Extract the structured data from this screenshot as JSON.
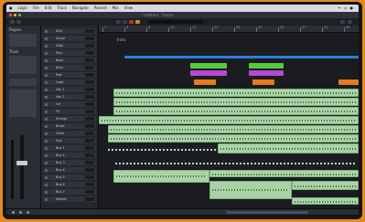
{
  "menubar": {
    "apple": "",
    "items": [
      "Logic",
      "File",
      "Edit",
      "Track",
      "Navigate",
      "Record",
      "Mix",
      "View"
    ],
    "status": [
      "ᯤ",
      "▭",
      "●"
    ]
  },
  "window": {
    "title": "Untitled - Tracks"
  },
  "inspector": {
    "region_label": "Region",
    "track_label": "Track"
  },
  "tracks": [
    {
      "name": "Kick"
    },
    {
      "name": "Snare"
    },
    {
      "name": "Hats"
    },
    {
      "name": "Perc"
    },
    {
      "name": "Bass"
    },
    {
      "name": "Keys"
    },
    {
      "name": "Pad"
    },
    {
      "name": "Lead"
    },
    {
      "name": "Vox 1"
    },
    {
      "name": "Vox 2"
    },
    {
      "name": "Gtr"
    },
    {
      "name": "FX"
    },
    {
      "name": "Strings"
    },
    {
      "name": "Brass"
    },
    {
      "name": "Choir"
    },
    {
      "name": "Sub"
    },
    {
      "name": "Bus 1"
    },
    {
      "name": "Bus 2"
    },
    {
      "name": "Bus 3"
    },
    {
      "name": "Bus 4"
    },
    {
      "name": "Bus 5"
    },
    {
      "name": "Bus 6"
    },
    {
      "name": "Bus 7"
    },
    {
      "name": "Master"
    }
  ],
  "ruler": {
    "bars": [
      "1",
      "5",
      "9",
      "13",
      "17",
      "21",
      "25",
      "29",
      "33",
      "37",
      "41",
      "45"
    ]
  },
  "arrange": {
    "marker": "Intro"
  },
  "colors": {
    "audio_region": "#a9d3a6",
    "midi_region": "#1c1f24",
    "green_region": "#57c93c",
    "magenta_region": "#b548d6",
    "orange_region": "#e67a1e",
    "selection": "#2f7de1"
  }
}
